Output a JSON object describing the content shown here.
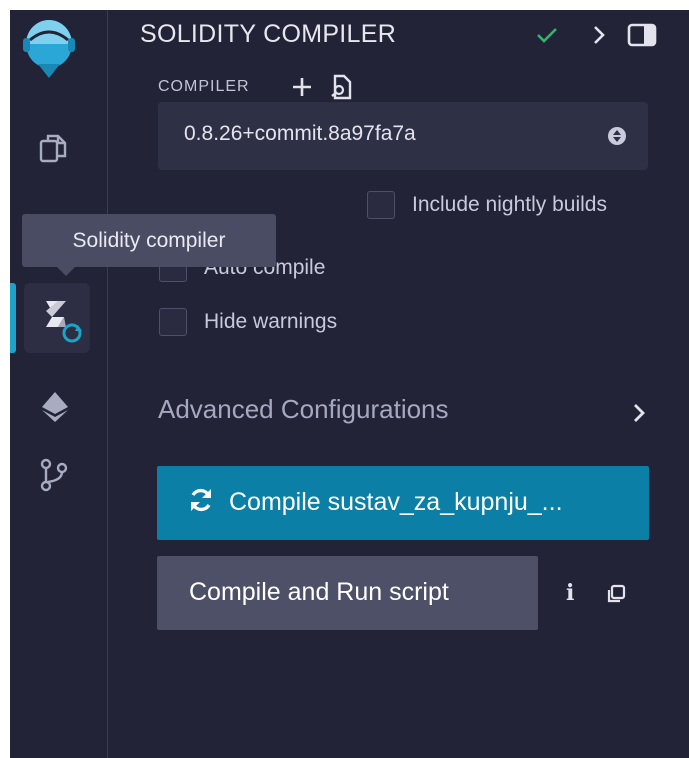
{
  "sidebar": {
    "tooltip": "Solidity compiler",
    "icons": [
      "remix-logo-icon",
      "file-explorer-icon",
      "solidity-compiler-icon",
      "deploy-run-icon",
      "git-icon"
    ]
  },
  "panel": {
    "title": "SOLIDITY COMPILER",
    "compiler_label": "COMPILER",
    "compiler_version": "0.8.26+commit.8a97fa7a",
    "include_nightly_label": "Include nightly builds",
    "auto_compile_label": "Auto compile",
    "hide_warnings_label": "Hide warnings",
    "advanced_label": "Advanced Configurations",
    "compile_button_label": "Compile sustav_za_kupnju_...",
    "compile_run_label": "Compile and Run script",
    "info_glyph": "i"
  },
  "colors": {
    "background": "#222336",
    "accent": "#0b7fa6",
    "success": "#2fb66c",
    "secondary_button": "#4e5068"
  }
}
